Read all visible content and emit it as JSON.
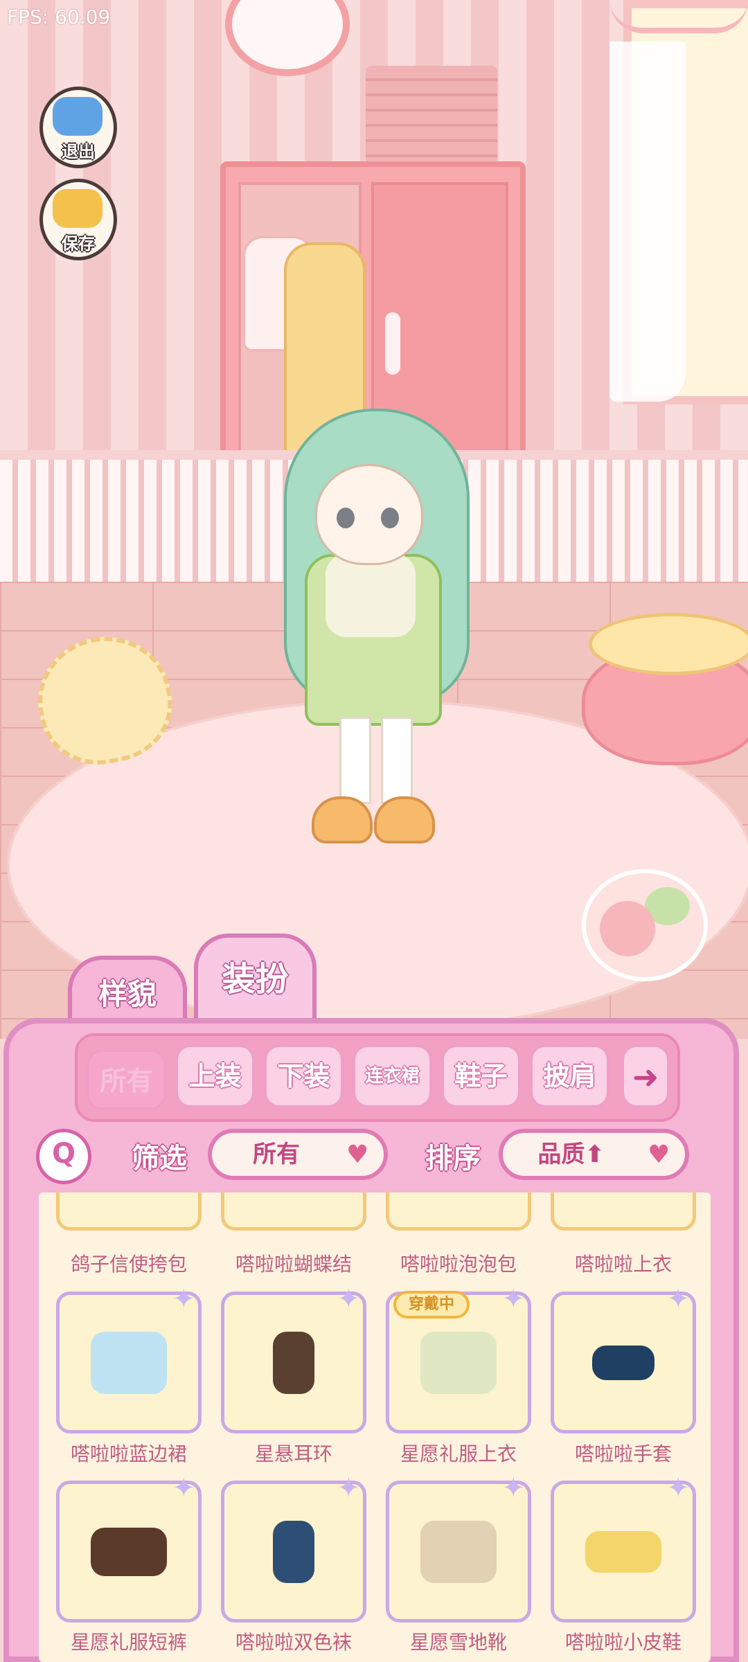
{
  "hud": {
    "fps": "FPS: 60.09"
  },
  "side_buttons": {
    "exit": "退出",
    "save": "保存"
  },
  "tabs": {
    "appearance": "样貌",
    "dressup": "装扮"
  },
  "categories": [
    "所有",
    "上装",
    "下装",
    "连衣裙",
    "鞋子",
    "披肩"
  ],
  "active_category": "所有",
  "filter": {
    "label": "筛选",
    "value": "所有"
  },
  "sort": {
    "label": "排序",
    "value": "品质⬆"
  },
  "equipped_badge": "穿戴中",
  "items_row_partial": [
    "鸽子信使挎包",
    "嗒啦啦蝴蝶结",
    "嗒啦啦泡泡包",
    "嗒啦啦上衣"
  ],
  "items_row_2": [
    "嗒啦啦蓝边裙",
    "星悬耳环",
    "星愿礼服上衣",
    "嗒啦啦手套"
  ],
  "items_row_3": [
    "星愿礼服短裤",
    "嗒啦啦双色袜",
    "星愿雪地靴",
    "嗒啦啦小皮鞋"
  ],
  "icons": [
    "exit-icon",
    "save-icon",
    "search-icon",
    "next-arrow-icon",
    "heart-dropdown-icon",
    "sparkle-icon"
  ],
  "colors": {
    "panel": "#f6b6d6",
    "panel_border": "#e08fc2",
    "card_border": "#c9a8e6",
    "badge": "#f2b63c"
  }
}
